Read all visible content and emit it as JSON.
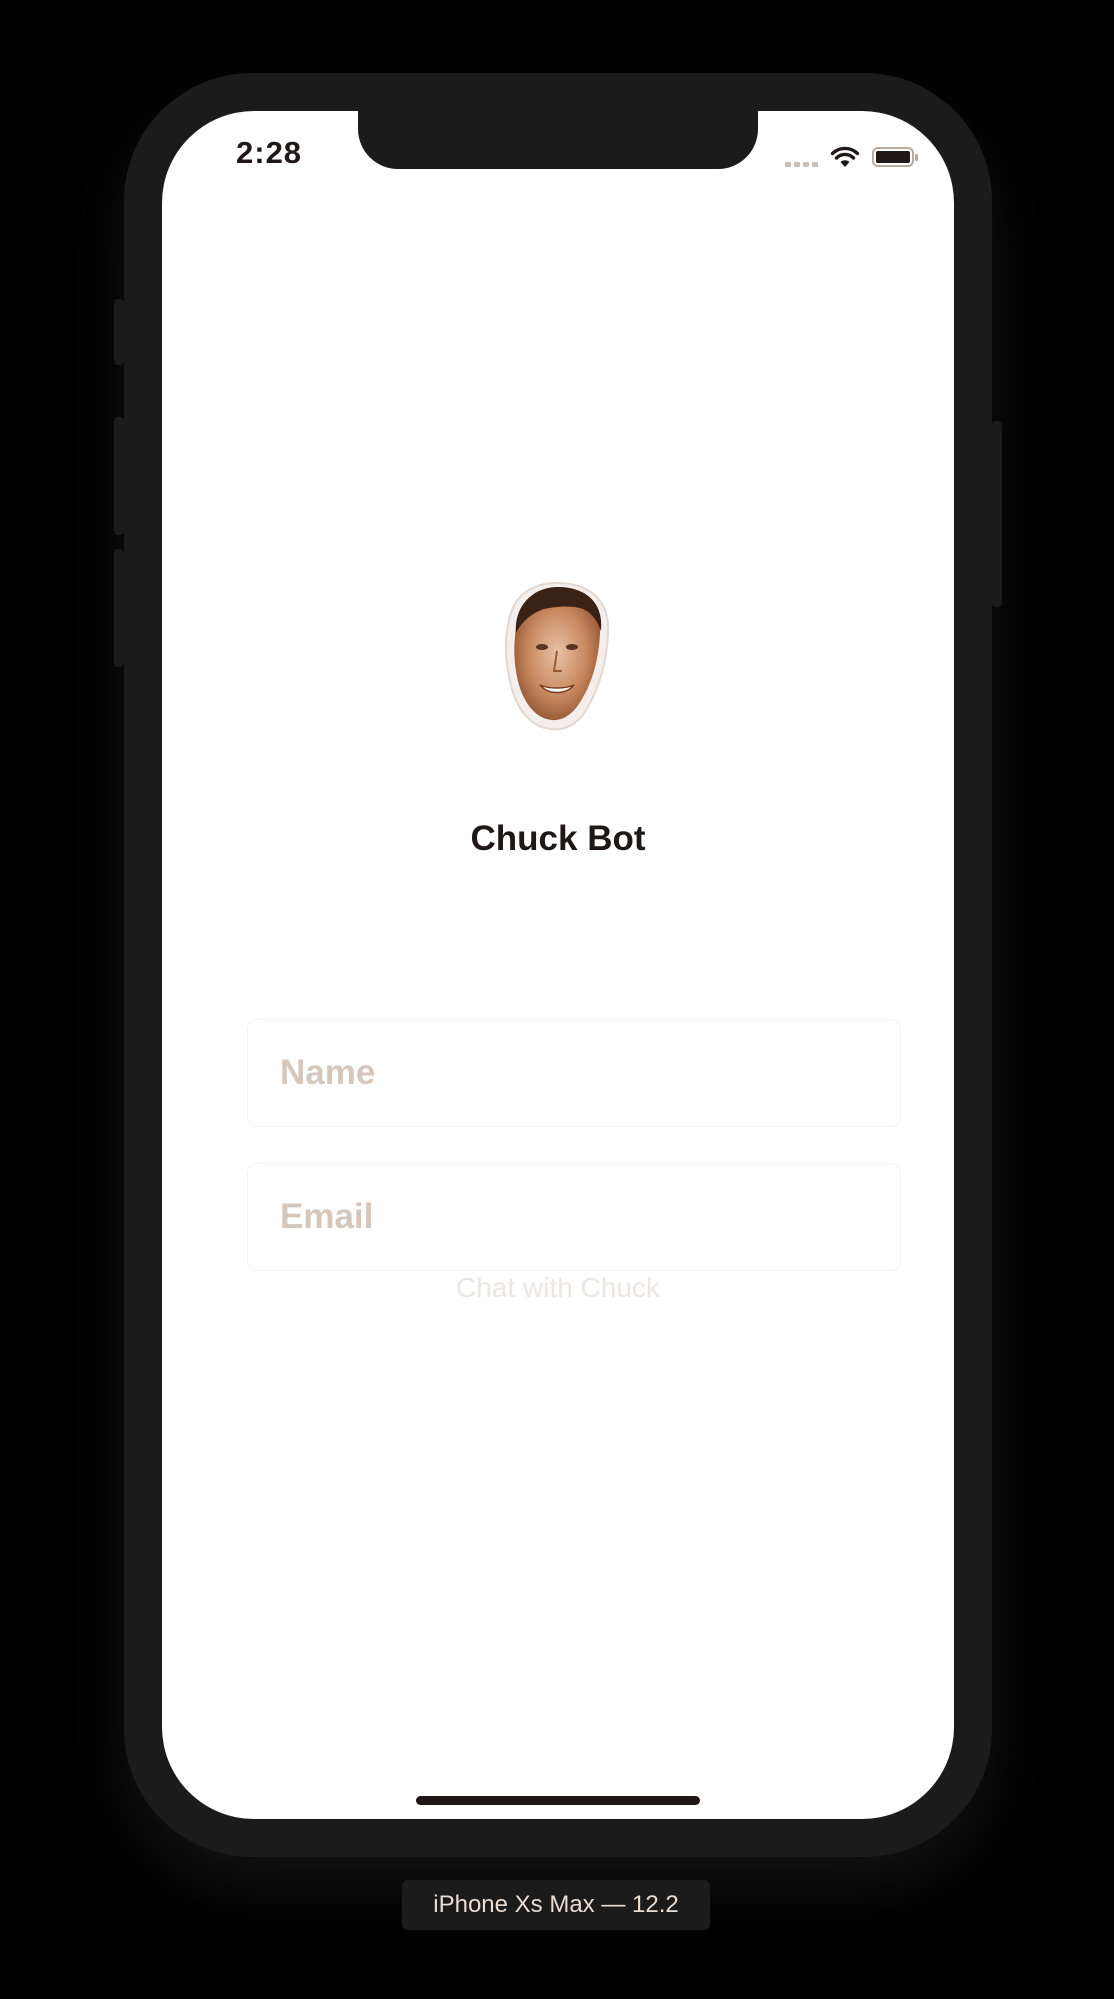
{
  "status_bar": {
    "time": "2:28"
  },
  "app": {
    "title": "Chuck Bot"
  },
  "form": {
    "name_placeholder": "Name",
    "email_placeholder": "Email",
    "submit_label": "Chat with Chuck"
  },
  "simulator": {
    "device_label": "iPhone Xs Max — 12.2"
  },
  "colors": {
    "background": "#000000",
    "device_frame": "#1b1b1c",
    "screen": "#ffffff",
    "text_primary": "#1e1816",
    "placeholder": "#d6c7bd",
    "button_disabled": "#ebe6e2"
  },
  "icons": [
    "signal-icon",
    "wifi-icon",
    "battery-icon",
    "chuck-avatar"
  ]
}
